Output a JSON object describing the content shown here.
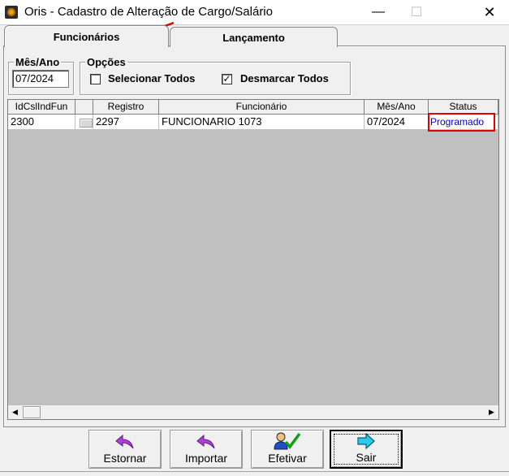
{
  "window": {
    "title": "Oris - Cadastro de Alteração de Cargo/Salário",
    "minimize_glyph": "—",
    "maximize_glyph": "☐",
    "close_glyph": "✕"
  },
  "tabs": [
    {
      "label": "Funcionários",
      "active": true
    },
    {
      "label": "Lançamento",
      "active": false
    }
  ],
  "mes_ano": {
    "legend": "Mês/Ano",
    "value": "07/2024"
  },
  "opcoes": {
    "legend": "Opções",
    "selecionar_todos": {
      "label": "Selecionar Todos",
      "checked": false
    },
    "desmarcar_todos": {
      "label": "Desmarcar Todos",
      "checked": true,
      "check_glyph": "✓"
    }
  },
  "grid": {
    "columns": [
      "IdCslIndFun",
      "",
      "Registro",
      "Funcionário",
      "Mês/Ano",
      "Status"
    ],
    "rows": [
      {
        "id": "2300",
        "registro": "2297",
        "funcionario": "FUNCIONARIO 1073",
        "mes_ano": "07/2024",
        "status": "Programado"
      }
    ],
    "status_color": "#0000d0",
    "highlight_color": "#e00000"
  },
  "scrollbar": {
    "left_glyph": "◀",
    "right_glyph": "▶"
  },
  "buttons": {
    "estornar": {
      "label": "Estornar",
      "icon": "purple-back-arrow-icon"
    },
    "importar": {
      "label": "Importar",
      "icon": "purple-back-arrow-icon"
    },
    "efetivar": {
      "label": "Efetivar",
      "icon": "person-checkmark-icon"
    },
    "sair": {
      "label": "Sair",
      "icon": "cyan-right-arrow-icon"
    }
  },
  "annotation": {
    "arrow_color": "#e00000"
  }
}
